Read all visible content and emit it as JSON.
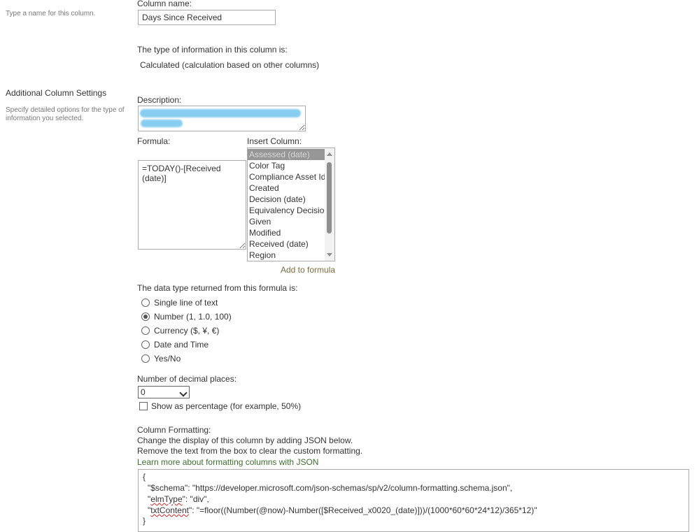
{
  "left": {
    "column_name_desc": "Type a name for this column.",
    "additional_title": "Additional Column Settings",
    "additional_desc": "Specify detailed options for the type of information you selected."
  },
  "column_name": {
    "label": "Column name:",
    "value": "Days Since Received"
  },
  "type_info": {
    "label": "The type of information in this column is:",
    "value": "Calculated (calculation based on other columns)"
  },
  "description": {
    "label": "Description:"
  },
  "formula": {
    "label": "Formula:",
    "value": "=TODAY()-[Received (date)]"
  },
  "insert_column": {
    "label": "Insert Column:",
    "items": [
      "Assessed (date)",
      "Color Tag",
      "Compliance Asset Id",
      "Created",
      "Decision (date)",
      "Equivalency Decision",
      "Given",
      "Modified",
      "Received (date)",
      "Region"
    ],
    "selected_index": 0,
    "add_link": "Add to formula"
  },
  "return_type": {
    "label": "The data type returned from this formula is:",
    "options": [
      "Single line of text",
      "Number (1, 1.0, 100)",
      "Currency ($, ¥, €)",
      "Date and Time",
      "Yes/No"
    ],
    "selected_index": 1
  },
  "decimals": {
    "label": "Number of decimal places:",
    "value": "0",
    "percentage_label": "Show as percentage (for example, 50%)"
  },
  "formatting": {
    "title": "Column Formatting:",
    "line1": "Change the display of this column by adding JSON below.",
    "line2": "Remove the text from the box to clear the custom formatting.",
    "link": "Learn more about formatting columns with JSON",
    "json": {
      "open": "{",
      "schema_line": "\"$schema\": \"https://developer.microsoft.com/json-schemas/sp/v2/column-formatting.schema.json\",",
      "elm_q1": "\"",
      "elm_key": "elmType",
      "elm_rest": "\": \"div\",",
      "txt_q1": "\"",
      "txt_key": "txtContent",
      "txt_rest": "\": \"=floor((Number(@now)-Number([$Received_x0020_(date)]))/(1000*60*60*24*12)/365*12)\"",
      "close": "}"
    }
  },
  "colors": {
    "selection_bg": "#969696",
    "link_gold": "#7a6a3c",
    "link_green": "#3d6d2e",
    "redaction": "#87cdf0"
  }
}
